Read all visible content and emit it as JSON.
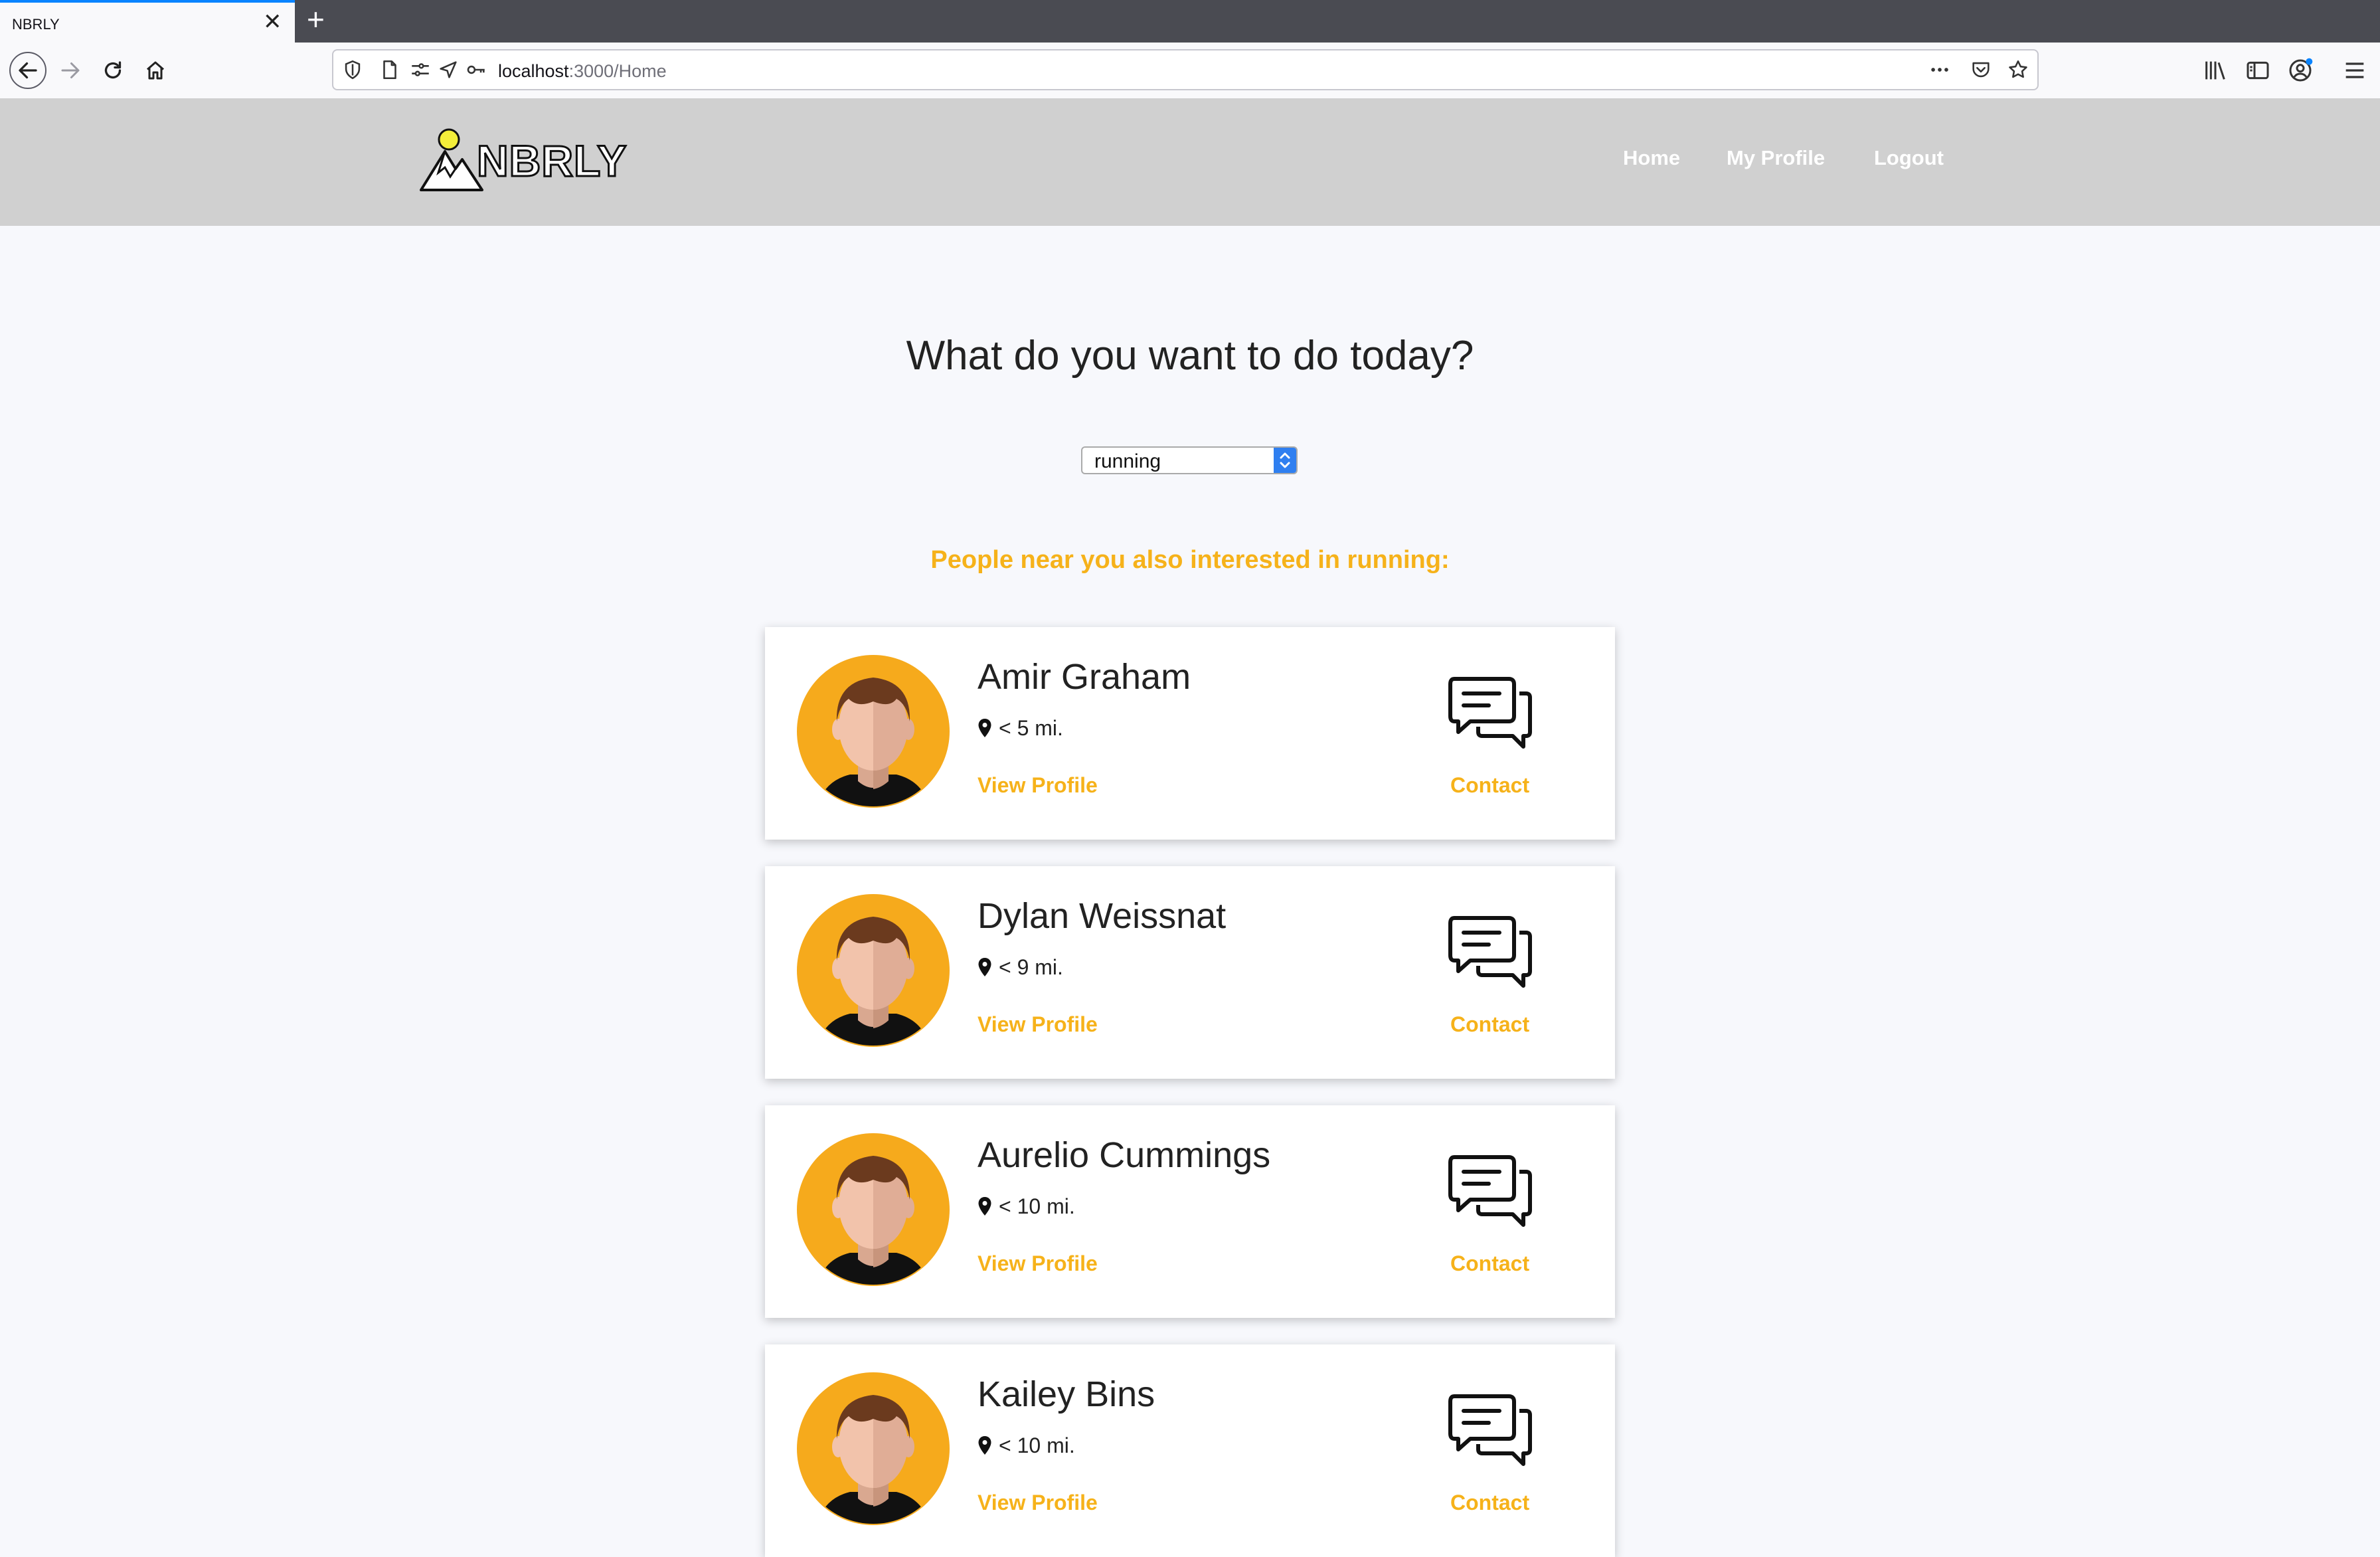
{
  "browser": {
    "tab_title": "NBRLY",
    "tab_close": "✕",
    "new_tab": "+",
    "url_host": "localhost",
    "url_path": ":3000/Home"
  },
  "site": {
    "logo_text": "NBRLY",
    "menu": [
      "Home",
      "My Profile",
      "Logout"
    ]
  },
  "main": {
    "headline": "What do you want to do today?",
    "activity_select": "running",
    "subheading": "People near you also interested in running:"
  },
  "people": [
    {
      "name": "Amir Graham",
      "distance": "< 5 mi.",
      "view": "View Profile",
      "contact": "Contact"
    },
    {
      "name": "Dylan Weissnat",
      "distance": "< 9 mi.",
      "view": "View Profile",
      "contact": "Contact"
    },
    {
      "name": "Aurelio Cummings",
      "distance": "< 10 mi.",
      "view": "View Profile",
      "contact": "Contact"
    },
    {
      "name": "Kailey Bins",
      "distance": "< 10 mi.",
      "view": "View Profile",
      "contact": "Contact"
    }
  ],
  "colors": {
    "accent": "#f6b21a",
    "header_bg": "#d0d0d0",
    "page_bg": "#f7f8fc"
  },
  "icons": [
    "back-arrow-icon",
    "forward-arrow-icon",
    "reload-icon",
    "home-icon",
    "shield-icon",
    "page-icon",
    "permissions-icon",
    "location-icon",
    "key-icon",
    "more-icon",
    "pocket-icon",
    "bookmark-star-icon",
    "library-icon",
    "sidebar-icon",
    "account-icon",
    "menu-icon",
    "map-pin-icon",
    "chat-bubbles-icon"
  ]
}
